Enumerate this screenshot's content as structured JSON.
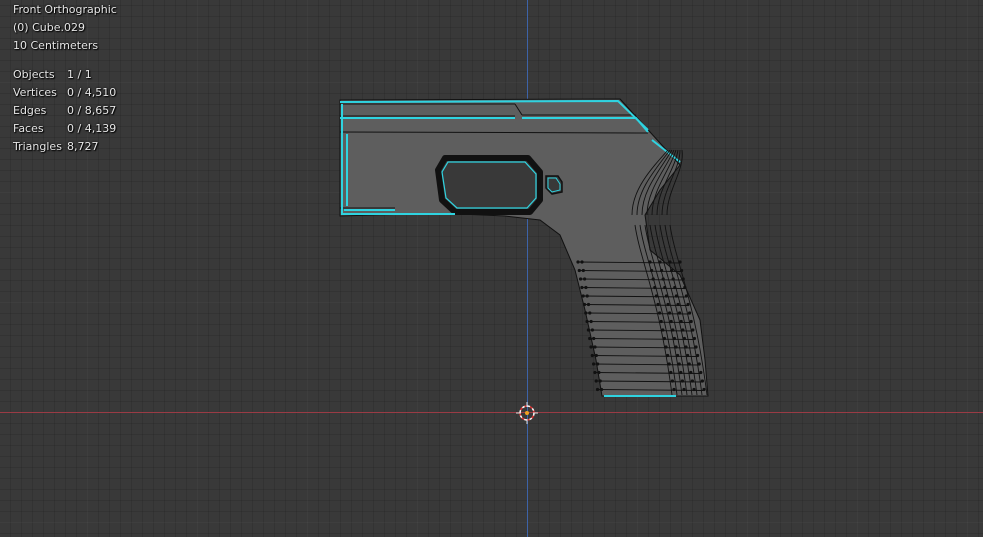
{
  "viewport": {
    "view_name": "Front Orthographic",
    "object_label": "(0) Cube.029",
    "grid_scale": "10 Centimeters",
    "colors": {
      "background": "#393939",
      "x_axis": "#9a3b45",
      "z_axis": "#3d63a8",
      "seam_edges": "#2fd3e0",
      "mesh_fill": "#5e5e5e",
      "wire": "#111111"
    }
  },
  "stats": [
    {
      "label": "Objects",
      "value": "1 / 1"
    },
    {
      "label": "Vertices",
      "value": "0 / 4,510"
    },
    {
      "label": "Edges",
      "value": "0 / 8,657"
    },
    {
      "label": "Faces",
      "value": "0 / 4,139"
    },
    {
      "label": "Triangles",
      "value": "8,727"
    }
  ],
  "icons": {
    "cursor": "3d-cursor-icon",
    "object": "mesh-object"
  }
}
